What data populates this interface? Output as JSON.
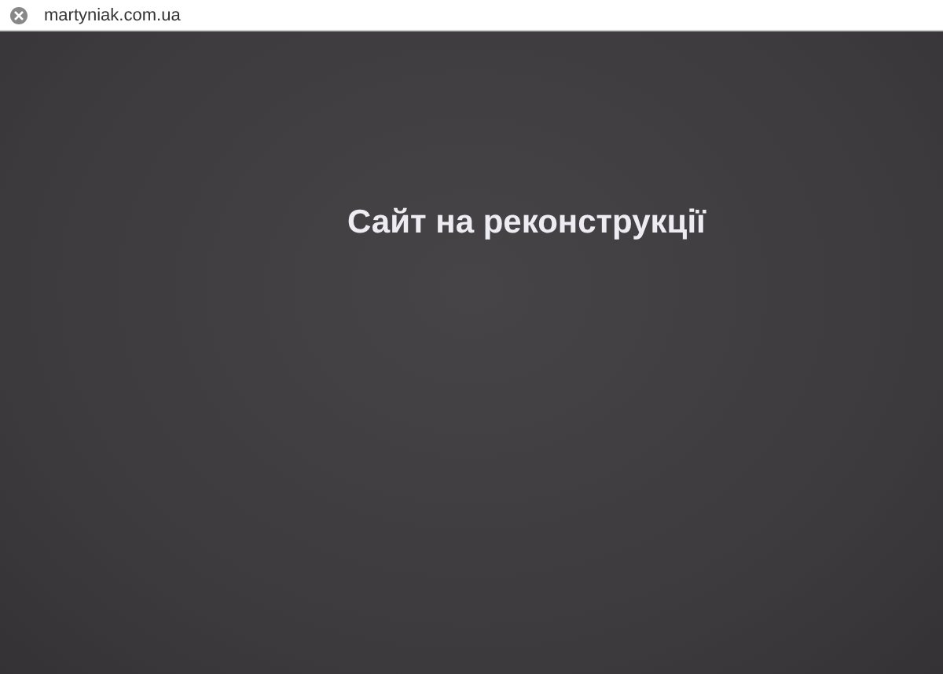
{
  "address_bar": {
    "url": "martyniak.com.ua"
  },
  "page": {
    "heading": "Сайт на реконструкції"
  }
}
